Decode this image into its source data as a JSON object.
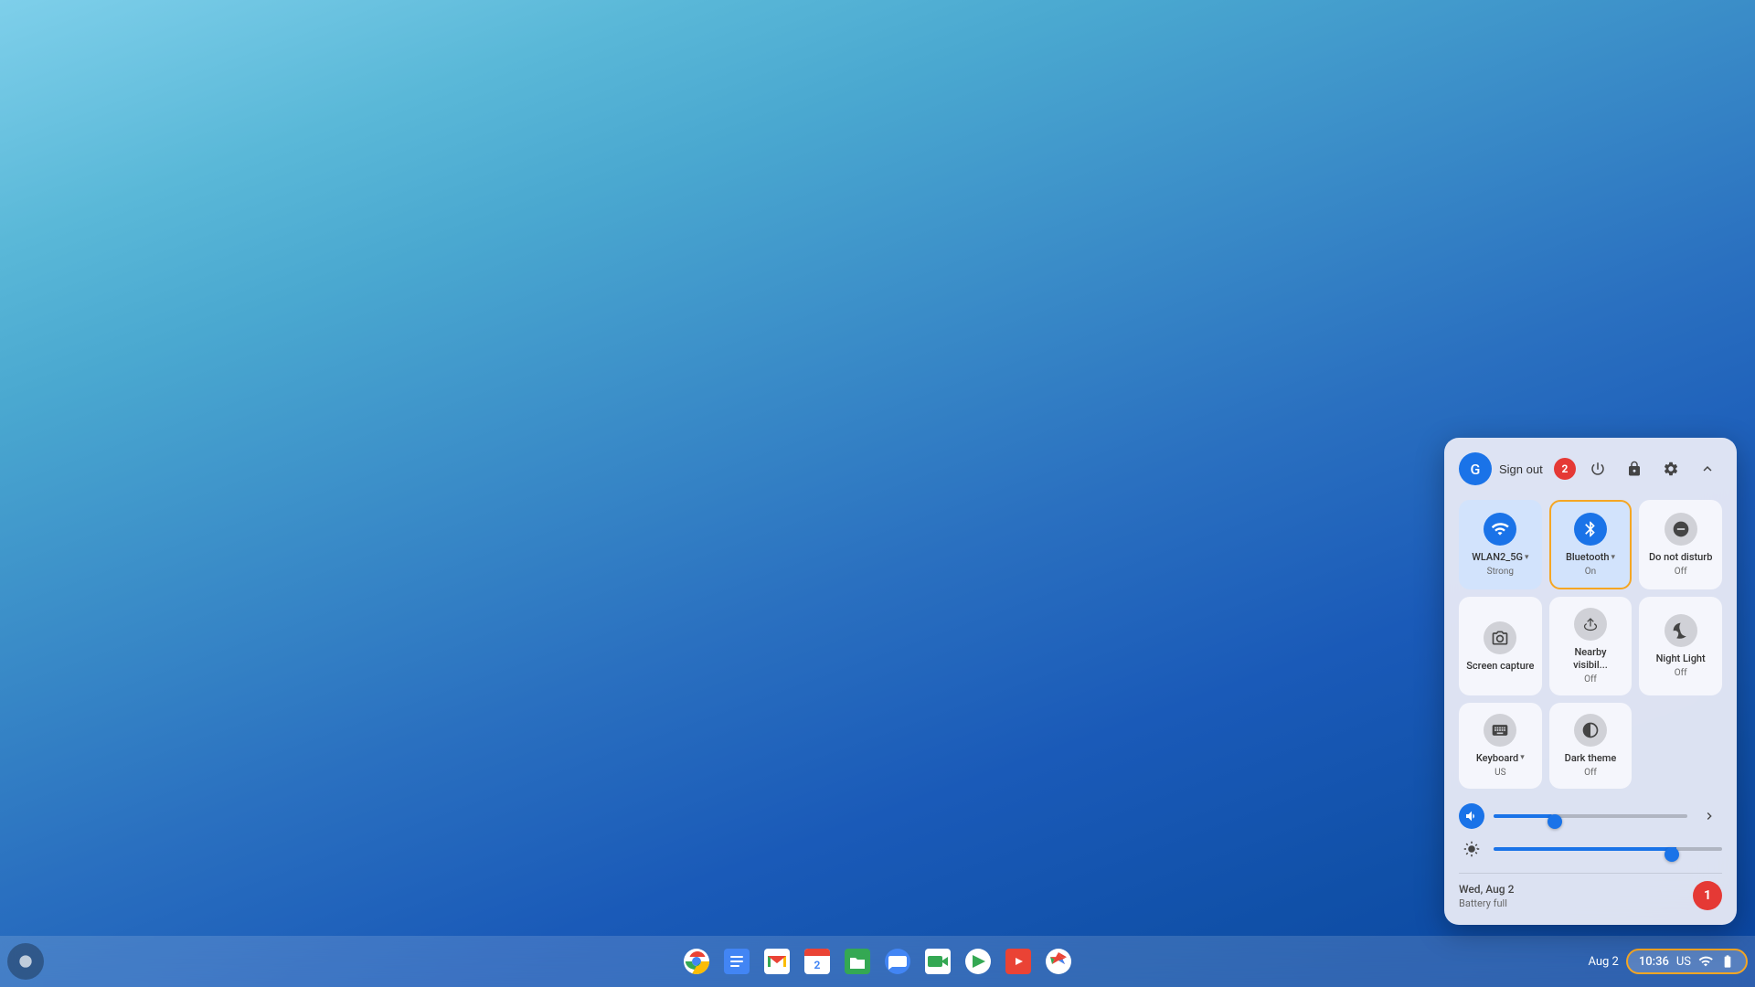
{
  "desktop": {
    "background": "chromeos-blue-gradient"
  },
  "quick_settings": {
    "user_avatar_letter": "G",
    "sign_out_label": "Sign out",
    "notification_count": "2",
    "header_buttons": {
      "power": "⏻",
      "lock": "🔒",
      "settings": "⚙",
      "collapse": "∧"
    },
    "tiles": [
      {
        "id": "wifi",
        "icon": "wifi",
        "label": "WLAN2_5G",
        "sublabel": "Strong",
        "active": true,
        "has_dropdown": true
      },
      {
        "id": "bluetooth",
        "icon": "bluetooth",
        "label": "Bluetooth",
        "sublabel": "On",
        "active": true,
        "has_dropdown": true,
        "highlighted": true
      },
      {
        "id": "do-not-disturb",
        "icon": "do_not_disturb",
        "label": "Do not disturb",
        "sublabel": "Off",
        "active": false,
        "has_dropdown": false
      },
      {
        "id": "screen-capture",
        "icon": "screen_capture",
        "label": "Screen capture",
        "sublabel": "",
        "active": false,
        "has_dropdown": false
      },
      {
        "id": "nearby-share",
        "icon": "nearby_share",
        "label": "Nearby visibil...",
        "sublabel": "Off",
        "active": false,
        "has_dropdown": false
      },
      {
        "id": "night-light",
        "icon": "night_light",
        "label": "Night Light",
        "sublabel": "Off",
        "active": false,
        "has_dropdown": false
      },
      {
        "id": "keyboard",
        "icon": "keyboard",
        "label": "Keyboard",
        "sublabel": "US",
        "active": false,
        "has_dropdown": true
      },
      {
        "id": "dark-theme",
        "icon": "dark_theme",
        "label": "Dark theme",
        "sublabel": "Off",
        "active": false,
        "has_dropdown": false
      }
    ],
    "sliders": {
      "volume": {
        "value": 30,
        "icon": "volume"
      },
      "brightness": {
        "value": 80,
        "icon": "brightness"
      }
    },
    "footer": {
      "date": "Wed, Aug 2",
      "battery": "Battery full"
    }
  },
  "taskbar": {
    "time": "10:36",
    "locale": "US",
    "date": "Aug 2",
    "notification_count": "1",
    "apps": [
      {
        "id": "chrome",
        "label": "Chrome"
      },
      {
        "id": "docs",
        "label": "Google Docs"
      },
      {
        "id": "gmail",
        "label": "Gmail"
      },
      {
        "id": "calendar",
        "label": "Google Calendar"
      },
      {
        "id": "files",
        "label": "Files"
      },
      {
        "id": "messages",
        "label": "Messages"
      },
      {
        "id": "meet",
        "label": "Google Meet"
      },
      {
        "id": "play",
        "label": "Google Play"
      },
      {
        "id": "youtube",
        "label": "YouTube"
      },
      {
        "id": "photos",
        "label": "Google Photos"
      }
    ]
  }
}
